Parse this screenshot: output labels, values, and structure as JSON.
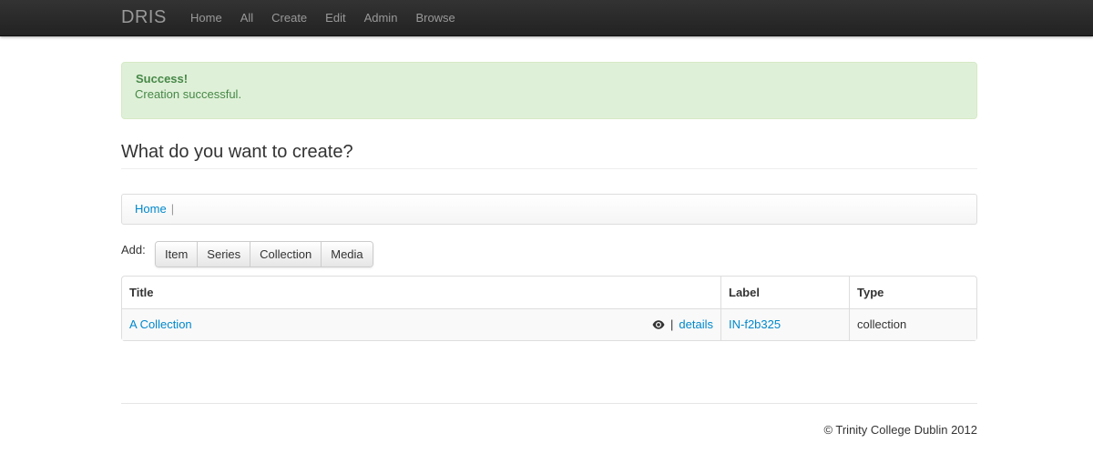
{
  "navbar": {
    "brand": "DRIS",
    "items": [
      "Home",
      "All",
      "Create",
      "Edit",
      "Admin",
      "Browse"
    ]
  },
  "alert": {
    "title": "Success!",
    "message": "Creation successful."
  },
  "page": {
    "heading": "What do you want to create?"
  },
  "breadcrumb": {
    "home": "Home",
    "separator": "|"
  },
  "add": {
    "label": "Add:",
    "buttons": [
      "Item",
      "Series",
      "Collection",
      "Media"
    ]
  },
  "table": {
    "headers": [
      "Title",
      "Label",
      "Type"
    ],
    "rows": [
      {
        "title": "A Collection",
        "action_separator": "|",
        "details_link": "details",
        "label": "IN-f2b325",
        "type": "collection"
      }
    ]
  },
  "footer": {
    "text": "© Trinity College Dublin 2012"
  },
  "colors": {
    "navbar": "#222222",
    "link": "#0088cc",
    "alert_bg": "#dff0d8",
    "alert_text": "#468847"
  }
}
